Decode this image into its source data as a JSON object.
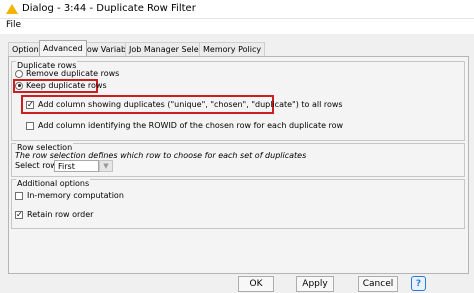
{
  "window": {
    "title": "Dialog - 3:44 - Duplicate Row Filter",
    "icon": "warning-triangle-icon"
  },
  "menu": {
    "file": "File"
  },
  "tabs": [
    "Options",
    "Advanced",
    "Flow Variables",
    "Job Manager Selection",
    "Memory Policy"
  ],
  "active_tab": "Advanced",
  "duplicate_rows": {
    "title": "Duplicate rows",
    "remove_label": "Remove duplicate rows",
    "keep_label": "Keep duplicate rows",
    "keep_selected": true,
    "add_column_label": "Add column showing duplicates (\"unique\", \"chosen\", \"duplicate\") to all rows",
    "add_column_checked": true,
    "rowid_label": "Add column identifying the ROWID of the chosen row for each duplicate row",
    "rowid_checked": false
  },
  "row_selection": {
    "title": "Row selection",
    "description": "The row selection defines which row to choose for each set of duplicates",
    "select_label": "Select row:",
    "selected_value": "First"
  },
  "additional": {
    "title": "Additional options",
    "in_memory_label": "In-memory computation",
    "in_memory_checked": false,
    "retain_order_label": "Retain row order",
    "retain_order_checked": true
  },
  "buttons": {
    "ok": "OK",
    "apply": "Apply",
    "cancel": "Cancel",
    "help": "?"
  },
  "colors": {
    "highlight": "#cc1f1f",
    "help_accent": "#2b7bd6"
  }
}
